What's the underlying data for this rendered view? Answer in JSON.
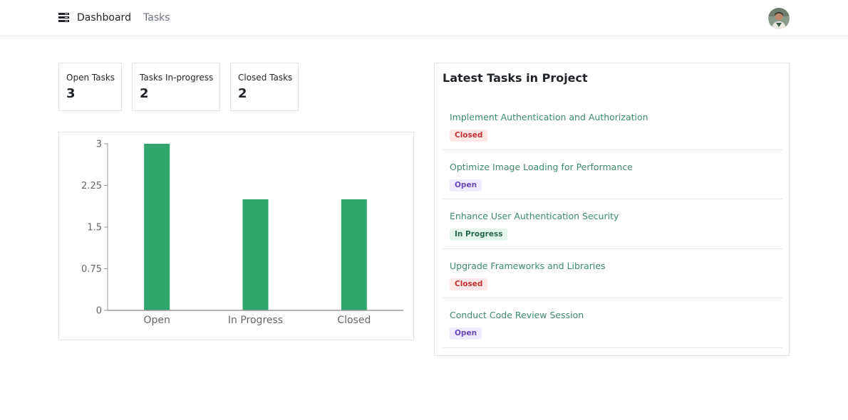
{
  "nav": {
    "brand_label": "Dashboard",
    "tasks_label": "Tasks",
    "brand_icon": "task-list-icon",
    "avatar_icon": "user-avatar"
  },
  "stats": {
    "open": {
      "label": "Open Tasks",
      "value": "3"
    },
    "in_progress": {
      "label": "Tasks In-progress",
      "value": "2"
    },
    "closed": {
      "label": "Closed Tasks",
      "value": "2"
    }
  },
  "chart_data": {
    "type": "bar",
    "categories": [
      "Open",
      "In Progress",
      "Closed"
    ],
    "values": [
      3,
      2,
      2
    ],
    "ylim": [
      0,
      3
    ],
    "yticks": [
      "0",
      "0.75",
      "1.5",
      "2.25",
      "3"
    ],
    "ytick_values": [
      0,
      0.75,
      1.5,
      2.25,
      3
    ],
    "grid": false,
    "bar_color": "#2fa66d",
    "title": "",
    "xlabel": "",
    "ylabel": ""
  },
  "latest": {
    "title": "Latest Tasks in Project",
    "items": [
      {
        "title": "Implement Authentication and Authorization",
        "status": "Closed"
      },
      {
        "title": "Optimize Image Loading for Performance",
        "status": "Open"
      },
      {
        "title": "Enhance User Authentication Security",
        "status": "In Progress"
      },
      {
        "title": "Upgrade Frameworks and Libraries",
        "status": "Closed"
      },
      {
        "title": "Conduct Code Review Session",
        "status": "Open"
      }
    ]
  },
  "colors": {
    "accent_green": "#2fa66d",
    "link_green": "#3d8a6a",
    "closed_badge_bg": "#fde8e8",
    "closed_badge_fg": "#c53030",
    "open_badge_bg": "#efeafd",
    "open_badge_fg": "#6b46c1",
    "progress_badge_bg": "#e3f6ea",
    "progress_badge_fg": "#276749"
  }
}
